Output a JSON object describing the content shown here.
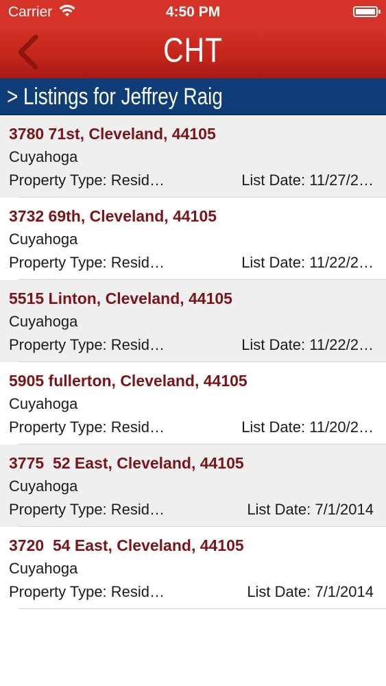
{
  "status_bar": {
    "carrier": "Carrier",
    "time": "4:50 PM",
    "battery_level": 1.0
  },
  "nav": {
    "title": "CHT",
    "back_icon": "chevron-left-icon"
  },
  "section": {
    "title": "> Listings for Jeffrey Raig"
  },
  "colors": {
    "nav_red": "#c4261b",
    "section_blue": "#0e3d78",
    "address_maroon": "#7a1418",
    "row_alt": "#efeff0"
  },
  "listings": [
    {
      "address": "3780 71st, Cleveland, 44105",
      "county": "Cuyahoga",
      "property_type": "Property Type: Resid…",
      "list_date": "List Date: 11/27/2…"
    },
    {
      "address": "3732 69th, Cleveland, 44105",
      "county": "Cuyahoga",
      "property_type": "Property Type: Resid…",
      "list_date": "List Date: 11/22/2…"
    },
    {
      "address": "5515 Linton, Cleveland, 44105",
      "county": "Cuyahoga",
      "property_type": "Property Type: Resid…",
      "list_date": "List Date: 11/22/2…"
    },
    {
      "address": "5905 fullerton, Cleveland, 44105",
      "county": "Cuyahoga",
      "property_type": "Property Type: Resid…",
      "list_date": "List Date: 11/20/2…"
    },
    {
      "address": "3775  52 East, Cleveland, 44105",
      "county": "Cuyahoga",
      "property_type": "Property Type: Resid…",
      "list_date": "List Date: 7/1/2014"
    },
    {
      "address": "3720  54 East, Cleveland, 44105",
      "county": "Cuyahoga",
      "property_type": "Property Type: Resid…",
      "list_date": "List Date: 7/1/2014"
    }
  ]
}
